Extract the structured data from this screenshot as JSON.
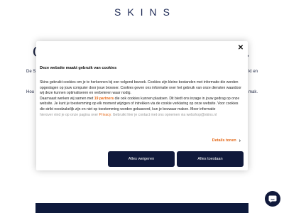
{
  "header": {
    "logo": "SKINS"
  },
  "background": {
    "heading_start": "C",
    "heading_end": ".",
    "text_left_1": "De S",
    "text_right_1": "kt en",
    "text_left_2": "Hou",
    "text_right_2": "mak."
  },
  "cookie_modal": {
    "title": "Deze website maakt gebruik van cookies",
    "paragraph1": "Skins gebruikt cookies om je te herkennen bij een volgend bezoek. Cookies zijn kleine bestanden met informatie die worden opgeslagen op jouw computer door jouw browser. Cookies geven ons informatie over het gebruik van onze diensten waardoor wij deze kunnen optimaliseren en verbeteren waar nodig.",
    "paragraph2_before": "Daarnaast werken wij samen met ",
    "partners_link": "19 partners",
    "paragraph2_after": " die ook cookies kunnen plaatsen. Dit biedt ons inzage in jouw gedrag op onze website. Je kunt je toestemming op elk moment wijzigen of intrekken via de cookie verklaring op onze website. Voor cookies die strikt noodzakelijk zijn en niet op toestemming worden gebaseerd, kun je bezwaar maken. Meer informatie",
    "faded_before": "hierover vind je op onze pagina over ",
    "faded_link": "Privacy",
    "faded_after": ". Gebruikt hier je contact met ons opnemen via webshop@skins.nl",
    "details_link": "Details tonen",
    "reject_button": "Alles weigeren",
    "accept_button": "Alles toestaan"
  },
  "icons": {
    "close": "close-icon",
    "details": "chevron-right-icon",
    "chat": "chat-icon"
  },
  "colors": {
    "navy": "#10193b",
    "accent": "#e56a1a"
  }
}
